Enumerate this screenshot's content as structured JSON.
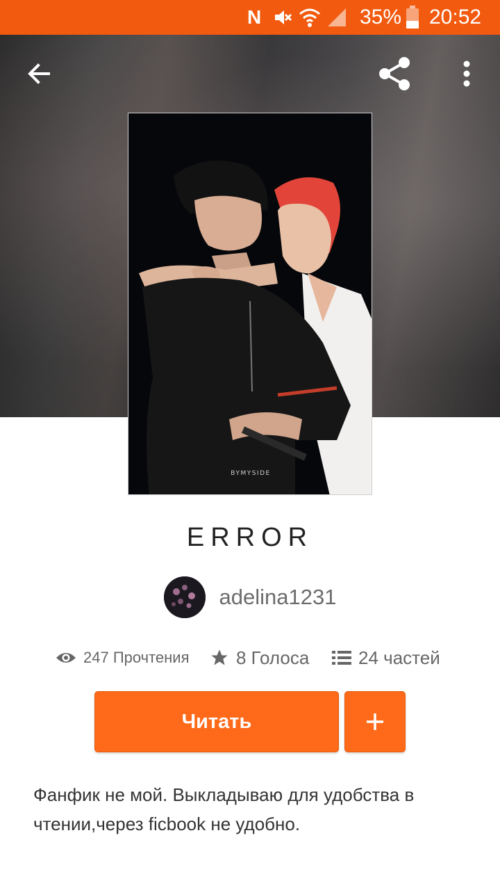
{
  "status_bar": {
    "nfc_icon": "nfc-icon",
    "mute_icon": "mute-icon",
    "wifi_icon": "wifi-icon",
    "signal_icon": "signal-icon",
    "battery_percent": "35%",
    "battery_icon": "battery-icon",
    "time": "20:52",
    "background": "#f25a0f"
  },
  "toolbar": {
    "back_icon": "arrow-left-icon",
    "share_icon": "share-icon",
    "more_icon": "more-vertical-icon"
  },
  "story": {
    "cover_watermark": "BYMYSIDE",
    "title": "ERROR",
    "author": "adelina1231",
    "stats": {
      "reads": "247 Прочтения",
      "votes": "8 Голоса",
      "parts": "24 частей"
    },
    "description": "Фанфик не мой. Выкладываю для удобства в чтении,через ficbook не удобно."
  },
  "actions": {
    "read_label": "Читать",
    "add_icon": "plus-icon",
    "accent": "#ff6a1a"
  }
}
